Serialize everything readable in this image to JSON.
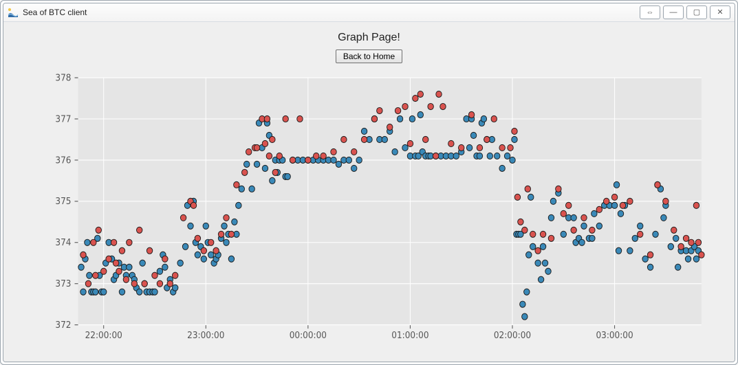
{
  "window": {
    "title": "Sea of BTC client",
    "buttons": {
      "undock": "⇔",
      "minimize": "—",
      "maximize": "▢",
      "close": "✕"
    }
  },
  "page": {
    "title": "Graph Page!",
    "home_button": "Back to Home"
  },
  "chart_data": {
    "type": "scatter",
    "xlabel": "",
    "ylabel": "",
    "x_ticks": [
      "22:00:00",
      "23:00:00",
      "00:00:00",
      "01:00:00",
      "02:00:00",
      "03:00:00"
    ],
    "x_range_hours": [
      21.75,
      27.85
    ],
    "ylim": [
      372,
      378
    ],
    "y_ticks": [
      372,
      373,
      374,
      375,
      376,
      377,
      378
    ],
    "colors": {
      "series_a": "#3a89b8",
      "series_b": "#d9534f",
      "edge": "#1a1a1a"
    },
    "series": [
      {
        "name": "series_a",
        "x": [
          21.78,
          21.8,
          21.82,
          21.84,
          21.86,
          21.88,
          21.9,
          21.92,
          21.94,
          21.96,
          21.98,
          22.0,
          22.02,
          22.05,
          22.08,
          22.1,
          22.12,
          22.15,
          22.18,
          22.2,
          22.22,
          22.25,
          22.28,
          22.3,
          22.32,
          22.35,
          22.38,
          22.4,
          22.42,
          22.45,
          22.48,
          22.5,
          22.55,
          22.58,
          22.6,
          22.62,
          22.65,
          22.68,
          22.7,
          22.75,
          22.8,
          22.82,
          22.85,
          22.88,
          22.9,
          22.92,
          22.95,
          22.98,
          23.0,
          23.02,
          23.05,
          23.08,
          23.1,
          23.12,
          23.15,
          23.18,
          23.2,
          23.22,
          23.25,
          23.28,
          23.3,
          23.32,
          23.35,
          23.4,
          23.45,
          23.5,
          23.52,
          23.55,
          23.58,
          23.6,
          23.62,
          23.65,
          23.68,
          23.7,
          23.72,
          23.75,
          23.78,
          23.8,
          23.85,
          23.9,
          23.95,
          24.0,
          24.05,
          24.1,
          24.15,
          24.2,
          24.25,
          24.3,
          24.35,
          24.4,
          24.45,
          24.5,
          24.55,
          24.6,
          24.65,
          24.7,
          24.75,
          24.8,
          24.85,
          24.9,
          24.95,
          25.0,
          25.02,
          25.05,
          25.08,
          25.1,
          25.12,
          25.15,
          25.18,
          25.2,
          25.25,
          25.3,
          25.35,
          25.4,
          25.45,
          25.5,
          25.55,
          25.58,
          25.6,
          25.62,
          25.65,
          25.68,
          25.7,
          25.72,
          25.75,
          25.78,
          25.8,
          25.85,
          25.9,
          25.95,
          26.0,
          26.02,
          26.04,
          26.06,
          26.08,
          26.1,
          26.12,
          26.14,
          26.16,
          26.18,
          26.2,
          26.25,
          26.28,
          26.3,
          26.32,
          26.35,
          26.38,
          26.4,
          26.45,
          26.5,
          26.55,
          26.6,
          26.62,
          26.65,
          26.68,
          26.7,
          26.75,
          26.78,
          26.8,
          26.85,
          26.9,
          26.95,
          27.0,
          27.02,
          27.04,
          27.06,
          27.1,
          27.15,
          27.2,
          27.25,
          27.3,
          27.35,
          27.4,
          27.42,
          27.45,
          27.48,
          27.5,
          27.55,
          27.6,
          27.62,
          27.65,
          27.7,
          27.72,
          27.75,
          27.78,
          27.8,
          27.82
        ],
        "y": [
          373.4,
          372.8,
          373.6,
          374.0,
          373.2,
          372.8,
          372.8,
          372.8,
          374.1,
          373.2,
          372.8,
          372.8,
          373.5,
          374.0,
          373.6,
          373.1,
          373.2,
          373.5,
          372.8,
          373.4,
          373.2,
          373.4,
          373.2,
          373.1,
          372.9,
          372.8,
          373.5,
          373.0,
          372.8,
          372.8,
          372.8,
          372.8,
          373.3,
          373.7,
          373.4,
          372.9,
          373.1,
          372.8,
          372.9,
          373.5,
          373.9,
          374.9,
          374.4,
          375.0,
          374.0,
          373.7,
          373.9,
          373.6,
          374.4,
          374.0,
          373.7,
          373.5,
          373.6,
          373.7,
          374.1,
          374.4,
          374.0,
          374.2,
          373.6,
          374.5,
          374.2,
          374.9,
          375.3,
          375.9,
          375.3,
          375.9,
          376.9,
          376.3,
          375.8,
          376.9,
          376.6,
          375.5,
          376.0,
          375.7,
          376.0,
          376.0,
          375.6,
          375.6,
          376.0,
          376.0,
          376.0,
          376.0,
          376.0,
          376.0,
          376.0,
          376.0,
          376.0,
          375.9,
          376.0,
          376.0,
          375.8,
          376.0,
          376.7,
          376.5,
          377.0,
          376.5,
          376.5,
          376.7,
          376.2,
          377.0,
          376.3,
          376.1,
          377.0,
          376.1,
          376.1,
          377.1,
          376.2,
          376.1,
          376.1,
          376.1,
          376.1,
          376.1,
          376.1,
          376.1,
          376.1,
          376.2,
          377.0,
          376.3,
          377.0,
          376.6,
          376.1,
          376.1,
          376.9,
          377.0,
          376.5,
          376.1,
          376.5,
          376.1,
          375.8,
          376.1,
          376.0,
          376.5,
          374.2,
          374.2,
          374.2,
          372.5,
          372.2,
          372.8,
          373.7,
          375.1,
          373.9,
          373.5,
          373.1,
          373.9,
          373.5,
          373.3,
          374.6,
          375.0,
          375.2,
          374.2,
          374.6,
          374.6,
          374.0,
          374.1,
          374.0,
          374.4,
          374.1,
          374.1,
          374.7,
          374.4,
          374.9,
          374.9,
          374.9,
          375.4,
          373.8,
          374.7,
          374.9,
          373.8,
          374.1,
          374.4,
          373.6,
          373.4,
          374.2,
          375.4,
          375.3,
          374.6,
          374.9,
          373.9,
          374.1,
          373.4,
          373.8,
          373.8,
          373.6,
          373.8,
          373.9,
          373.6,
          373.8
        ]
      },
      {
        "name": "series_b",
        "x": [
          21.8,
          21.85,
          21.9,
          21.92,
          21.95,
          22.0,
          22.05,
          22.1,
          22.12,
          22.15,
          22.18,
          22.22,
          22.25,
          22.3,
          22.35,
          22.4,
          22.45,
          22.5,
          22.55,
          22.6,
          22.65,
          22.7,
          22.78,
          22.85,
          22.88,
          22.92,
          22.98,
          23.05,
          23.1,
          23.15,
          23.2,
          23.25,
          23.3,
          23.38,
          23.42,
          23.48,
          23.5,
          23.55,
          23.58,
          23.6,
          23.62,
          23.65,
          23.68,
          23.72,
          23.78,
          23.85,
          23.92,
          24.0,
          24.08,
          24.15,
          24.25,
          24.35,
          24.45,
          24.55,
          24.65,
          24.7,
          24.8,
          24.88,
          24.95,
          25.0,
          25.05,
          25.1,
          25.15,
          25.2,
          25.25,
          25.28,
          25.32,
          25.4,
          25.5,
          25.6,
          25.68,
          25.75,
          25.82,
          25.9,
          25.98,
          26.02,
          26.05,
          26.08,
          26.12,
          26.15,
          26.2,
          26.25,
          26.3,
          26.38,
          26.45,
          26.5,
          26.55,
          26.6,
          26.7,
          26.78,
          26.85,
          26.92,
          27.0,
          27.08,
          27.15,
          27.25,
          27.35,
          27.42,
          27.5,
          27.58,
          27.65,
          27.7,
          27.75,
          27.8,
          27.82,
          27.85
        ],
        "y": [
          373.7,
          373.0,
          374.0,
          373.2,
          374.3,
          373.3,
          373.6,
          374.0,
          373.5,
          373.3,
          373.8,
          373.1,
          374.0,
          373.0,
          374.3,
          373.0,
          373.8,
          373.2,
          373.0,
          373.6,
          373.0,
          373.2,
          374.6,
          375.0,
          374.9,
          374.1,
          373.8,
          374.0,
          373.8,
          374.2,
          374.6,
          374.2,
          375.4,
          375.7,
          376.2,
          376.3,
          376.3,
          377.0,
          376.4,
          377.0,
          376.1,
          376.5,
          375.7,
          376.1,
          377.0,
          376.0,
          377.0,
          376.0,
          376.1,
          376.1,
          376.2,
          376.5,
          376.2,
          376.5,
          377.0,
          377.2,
          376.8,
          377.2,
          377.3,
          376.4,
          377.5,
          377.6,
          376.5,
          377.3,
          376.1,
          377.6,
          377.3,
          376.4,
          376.3,
          377.1,
          376.3,
          376.5,
          377.0,
          376.3,
          376.3,
          376.7,
          375.1,
          374.5,
          374.3,
          375.3,
          374.2,
          373.8,
          374.2,
          374.1,
          375.3,
          374.7,
          374.9,
          374.3,
          374.6,
          374.3,
          374.8,
          375.0,
          375.1,
          374.9,
          375.0,
          374.2,
          373.7,
          375.4,
          375.0,
          374.3,
          373.9,
          374.1,
          374.0,
          374.9,
          374.0,
          373.7
        ]
      }
    ]
  }
}
